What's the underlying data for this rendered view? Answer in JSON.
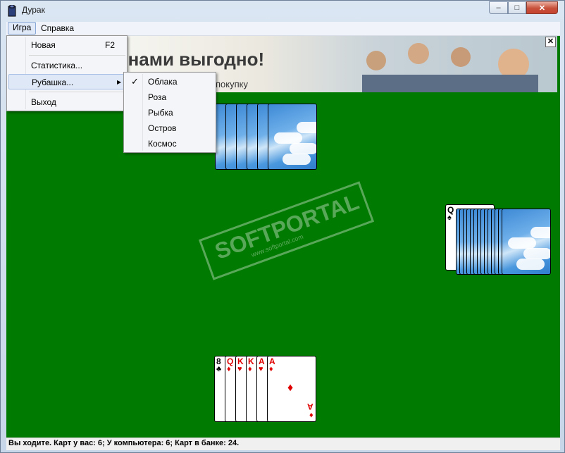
{
  "window": {
    "title": "Дурак",
    "minimize": "–",
    "maximize": "□",
    "close": "✕"
  },
  "menubar": {
    "game": "Игра",
    "help": "Справка"
  },
  "game_menu": {
    "new_label": "Новая",
    "new_key": "F2",
    "stats_label": "Статистика...",
    "back_label": "Рубашка...",
    "exit_label": "Выход"
  },
  "back_submenu": {
    "items": [
      "Облака",
      "Роза",
      "Рыбка",
      "Остров",
      "Космос"
    ],
    "checked": "✓"
  },
  "banner": {
    "headline": "- с нами выгодно!",
    "subline": "первую покупку",
    "close": "✕"
  },
  "watermark": {
    "text": "SOFTPORTAL",
    "sub": "www.softportal.com"
  },
  "player_hand": [
    {
      "rank": "8",
      "suit": "♣",
      "color": "black"
    },
    {
      "rank": "Q",
      "suit": "♦",
      "color": "red"
    },
    {
      "rank": "K",
      "suit": "♥",
      "color": "red"
    },
    {
      "rank": "K",
      "suit": "♦",
      "color": "red"
    },
    {
      "rank": "A",
      "suit": "♥",
      "color": "red"
    },
    {
      "rank": "A",
      "suit": "♦",
      "color": "red"
    }
  ],
  "trump_card": {
    "rank": "Q",
    "suit": "♠",
    "color": "black"
  },
  "status": {
    "text": "Вы ходите. Карт у вас: 6; У компьютера: 6; Карт в банке: 24."
  },
  "colors": {
    "table": "#007a00",
    "menu_highlight": "#dfe8f6"
  }
}
